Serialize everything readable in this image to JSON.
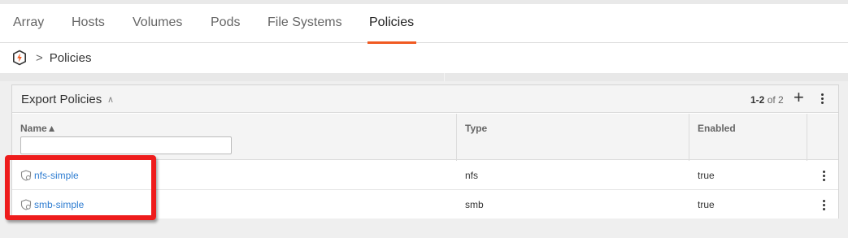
{
  "tabs": [
    {
      "label": "Array"
    },
    {
      "label": "Hosts"
    },
    {
      "label": "Volumes"
    },
    {
      "label": "Pods"
    },
    {
      "label": "File Systems"
    },
    {
      "label": "Policies",
      "active": true
    }
  ],
  "breadcrumb": {
    "separator": ">",
    "current": "Policies",
    "icon": "array-logo-icon"
  },
  "section": {
    "title": "Export Policies",
    "pager_range": "1-2",
    "pager_of": "of 2"
  },
  "table": {
    "columns": [
      {
        "label": "Name▲"
      },
      {
        "label": "Type"
      },
      {
        "label": "Enabled"
      }
    ],
    "filter_value": "",
    "rows": [
      {
        "name": "nfs-simple",
        "type": "nfs",
        "enabled": "true"
      },
      {
        "name": "smb-simple",
        "type": "smb",
        "enabled": "true"
      }
    ]
  },
  "colors": {
    "accent": "#f05a22",
    "link": "#2f7dd1",
    "highlight": "#ee1c1c"
  }
}
